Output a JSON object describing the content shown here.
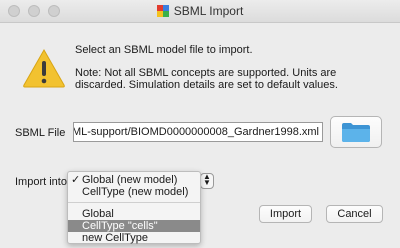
{
  "window": {
    "title": "SBML Import"
  },
  "message": {
    "primary": "Select an SBML model file to import.",
    "note": "Note: Not all SBML concepts are supported. Units are discarded. Simulation details are set to default values."
  },
  "file": {
    "label": "SBML File",
    "value": "BML-support/BIOMD0000000008_Gardner1998.xml"
  },
  "import_into": {
    "label": "Import into",
    "menu": [
      {
        "label": "Global (new model)",
        "checked": true
      },
      {
        "label": "CellType (new model)"
      },
      {
        "label": "Global"
      },
      {
        "label": "CellType \"cells\"",
        "highlighted": true
      },
      {
        "label": "new CellType"
      }
    ]
  },
  "buttons": {
    "import": "Import",
    "cancel": "Cancel"
  },
  "icons": {
    "warning": "warning-icon",
    "folder": "folder-icon",
    "app": "app-icon"
  },
  "colors": {
    "warning": "#f2c230",
    "folder": "#4aa3df",
    "selection": "#8a8a8a"
  }
}
